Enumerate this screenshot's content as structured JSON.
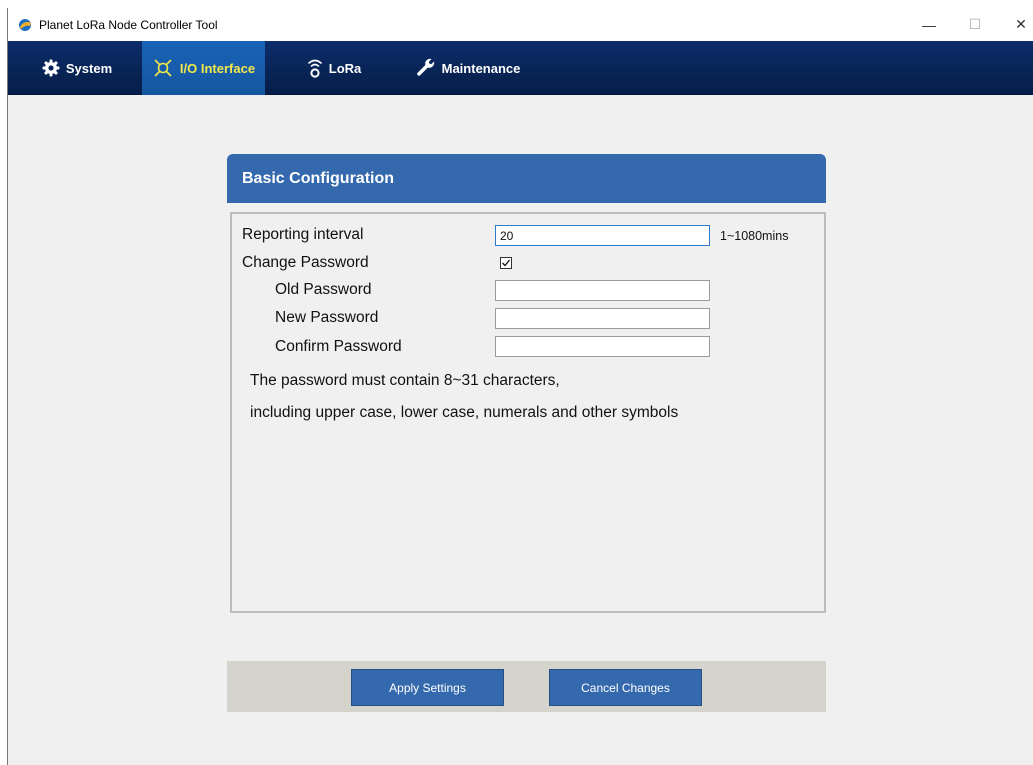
{
  "window": {
    "title": "Planet LoRa Node Controller Tool",
    "controls": {
      "minimize": "—",
      "maximize": "☐",
      "close": "✕"
    }
  },
  "nav": {
    "items": [
      {
        "label": "System",
        "icon": "gear-icon"
      },
      {
        "label": "I/O Interface",
        "icon": "io-connector-icon",
        "active": true
      },
      {
        "label": "LoRa",
        "icon": "wireless-signal-icon"
      },
      {
        "label": "Maintenance",
        "icon": "wrench-icon"
      }
    ]
  },
  "card": {
    "title": "Basic Configuration",
    "reporting_interval": {
      "label": "Reporting interval",
      "value": "20",
      "unit": "1~1080mins"
    },
    "change_password": {
      "label": "Change Password",
      "checked": true
    },
    "old_password": {
      "label": "Old Password",
      "value": ""
    },
    "new_password": {
      "label": "New Password",
      "value": ""
    },
    "confirm_password": {
      "label": "Confirm Password",
      "value": ""
    },
    "note_line1": "The password must contain 8~31 characters,",
    "note_line2": "including upper case, lower case, numerals and other symbols"
  },
  "actions": {
    "apply_label": "Apply Settings",
    "cancel_label": "Cancel Changes"
  },
  "colors": {
    "nav_background": "#082455",
    "nav_active": "#1a63b6",
    "nav_active_text": "#f2e84a",
    "card_header": "#3569ad",
    "button": "#3569ad",
    "action_bar": "#d4d4cc"
  }
}
